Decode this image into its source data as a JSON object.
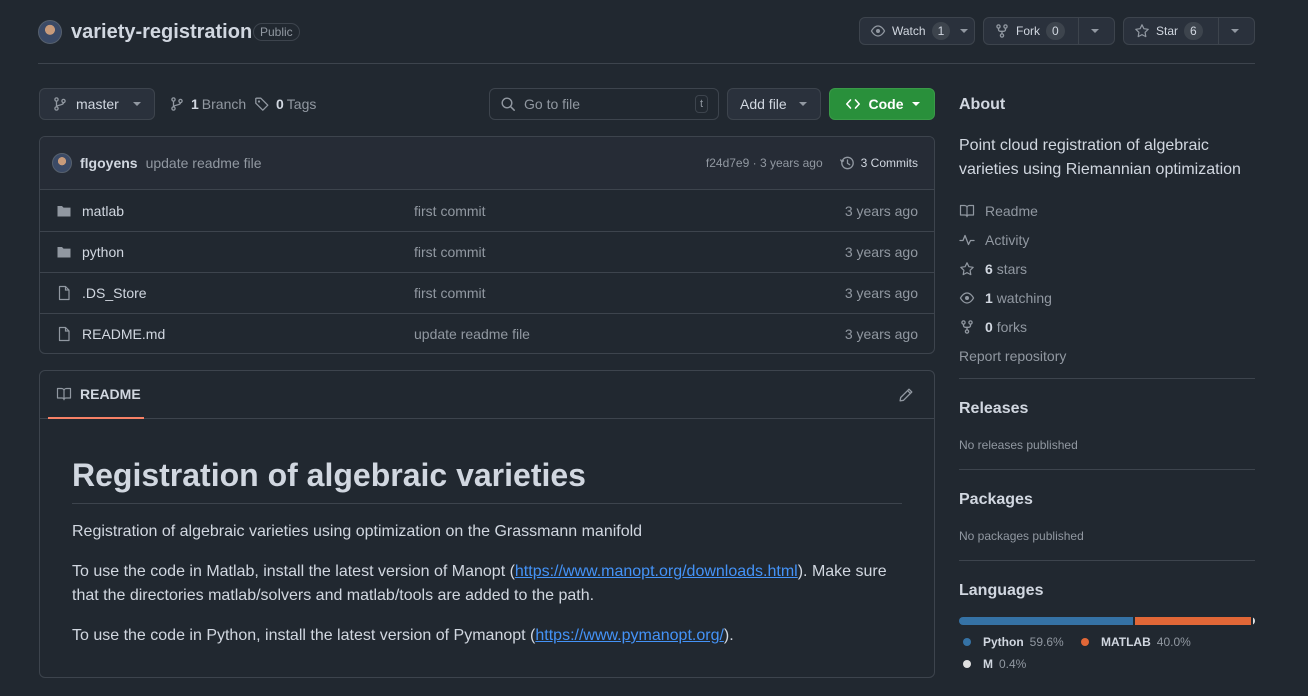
{
  "repo": {
    "name": "variety-registration",
    "visibility": "Public",
    "watch": {
      "label": "Watch",
      "count": "1"
    },
    "fork": {
      "label": "Fork",
      "count": "0"
    },
    "star": {
      "label": "Star",
      "count": "6"
    }
  },
  "toolbar": {
    "branch": "master",
    "branches_count": "1",
    "branches_label": "Branch",
    "tags_count": "0",
    "tags_label": "Tags",
    "search_placeholder": "Go to file",
    "search_shortcut": "t",
    "add_file": "Add file",
    "code": "Code"
  },
  "latest_commit": {
    "author": "flgoyens",
    "message": "update readme file",
    "sha_time": "f24d7e9 · 3 years ago",
    "commits": "3 Commits"
  },
  "files": [
    {
      "name": "matlab",
      "type": "folder",
      "message": "first commit",
      "age": "3 years ago"
    },
    {
      "name": "python",
      "type": "folder",
      "message": "first commit",
      "age": "3 years ago"
    },
    {
      "name": ".DS_Store",
      "type": "file",
      "message": "first commit",
      "age": "3 years ago"
    },
    {
      "name": "README.md",
      "type": "file",
      "message": "update readme file",
      "age": "3 years ago"
    }
  ],
  "readme": {
    "tab": "README",
    "title": "Registration of algebraic varieties",
    "p1": "Registration of algebraic varieties using optimization on the Grassmann manifold",
    "p2_before": "To use the code in Matlab, install the latest version of Manopt (",
    "p2_link": "https://www.manopt.org/downloads.html",
    "p2_after": "). Make sure that the directories matlab/solvers and matlab/tools are added to the path.",
    "p3_before": "To use the code in Python, install the latest version of Pymanopt (",
    "p3_link": "https://www.pymanopt.org/",
    "p3_after": ")."
  },
  "about": {
    "heading": "About",
    "description": "Point cloud registration of algebraic varieties using Riemannian optimization",
    "readme": "Readme",
    "activity": "Activity",
    "stars_count": "6",
    "stars_label": "stars",
    "watching_count": "1",
    "watching_label": "watching",
    "forks_count": "0",
    "forks_label": "forks",
    "report": "Report repository"
  },
  "releases": {
    "heading": "Releases",
    "text": "No releases published"
  },
  "packages": {
    "heading": "Packages",
    "text": "No packages published"
  },
  "languages": {
    "heading": "Languages",
    "items": [
      {
        "name": "Python",
        "percent": "59.6%",
        "value": 59.6,
        "color": "#3572A5"
      },
      {
        "name": "MATLAB",
        "percent": "40.0%",
        "value": 40.0,
        "color": "#e16737"
      },
      {
        "name": "M",
        "percent": "0.4%",
        "value": 0.4,
        "color": "#e0e0e0"
      }
    ]
  }
}
